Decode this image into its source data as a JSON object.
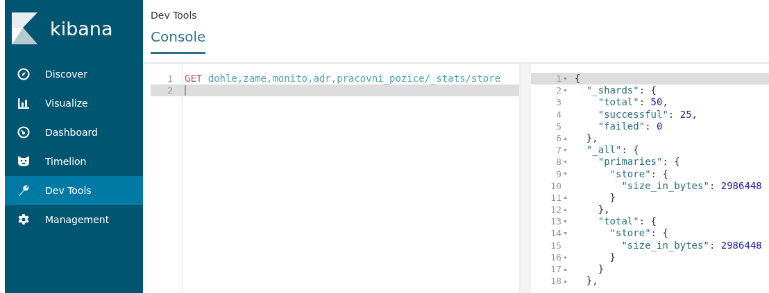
{
  "sidebar": {
    "logo_text": "kibana",
    "items": [
      {
        "label": "Discover",
        "selected": false
      },
      {
        "label": "Visualize",
        "selected": false
      },
      {
        "label": "Dashboard",
        "selected": false
      },
      {
        "label": "Timelion",
        "selected": false
      },
      {
        "label": "Dev Tools",
        "selected": true
      },
      {
        "label": "Management",
        "selected": false
      }
    ]
  },
  "breadcrumb": "Dev Tools",
  "tabs": [
    {
      "label": "Console",
      "selected": true
    }
  ],
  "request": {
    "lines": [
      {
        "number": "1",
        "active": false,
        "tokens": [
          {
            "kind": "method",
            "text": "GET"
          },
          {
            "kind": "url",
            "text": "dohle,zame,monito,adr,pracovni_pozice/_stats/store"
          }
        ]
      },
      {
        "number": "2",
        "active": true
      }
    ]
  },
  "response": {
    "lines": [
      {
        "number": "1",
        "fold_start": true,
        "fold_end": false,
        "active": true,
        "tokens": [
          {
            "kind": "punct",
            "text": "{"
          }
        ]
      },
      {
        "number": "2",
        "fold_start": true,
        "fold_end": false,
        "active": false,
        "tokens": [
          {
            "kind": "key",
            "text": "  \"_shards\""
          },
          {
            "kind": "punct",
            "text": ": {"
          }
        ]
      },
      {
        "number": "3",
        "fold_start": false,
        "fold_end": false,
        "active": false,
        "tokens": [
          {
            "kind": "key",
            "text": "    \"total\""
          },
          {
            "kind": "punct",
            "text": ": "
          },
          {
            "kind": "number",
            "text": "50"
          },
          {
            "kind": "punct",
            "text": ","
          }
        ]
      },
      {
        "number": "4",
        "fold_start": false,
        "fold_end": false,
        "active": false,
        "tokens": [
          {
            "kind": "key",
            "text": "    \"successful\""
          },
          {
            "kind": "punct",
            "text": ": "
          },
          {
            "kind": "number",
            "text": "25"
          },
          {
            "kind": "punct",
            "text": ","
          }
        ]
      },
      {
        "number": "5",
        "fold_start": false,
        "fold_end": false,
        "active": false,
        "tokens": [
          {
            "kind": "key",
            "text": "    \"failed\""
          },
          {
            "kind": "punct",
            "text": ": "
          },
          {
            "kind": "number",
            "text": "0"
          }
        ]
      },
      {
        "number": "6",
        "fold_start": false,
        "fold_end": true,
        "active": false,
        "tokens": [
          {
            "kind": "punct",
            "text": "  },"
          }
        ]
      },
      {
        "number": "7",
        "fold_start": true,
        "fold_end": false,
        "active": false,
        "tokens": [
          {
            "kind": "key",
            "text": "  \"_all\""
          },
          {
            "kind": "punct",
            "text": ": {"
          }
        ]
      },
      {
        "number": "8",
        "fold_start": true,
        "fold_end": false,
        "active": false,
        "tokens": [
          {
            "kind": "key",
            "text": "    \"primaries\""
          },
          {
            "kind": "punct",
            "text": ": {"
          }
        ]
      },
      {
        "number": "9",
        "fold_start": true,
        "fold_end": false,
        "active": false,
        "tokens": [
          {
            "kind": "key",
            "text": "      \"store\""
          },
          {
            "kind": "punct",
            "text": ": {"
          }
        ]
      },
      {
        "number": "10",
        "fold_start": false,
        "fold_end": false,
        "active": false,
        "tokens": [
          {
            "kind": "key",
            "text": "        \"size_in_bytes\""
          },
          {
            "kind": "punct",
            "text": ": "
          },
          {
            "kind": "number",
            "text": "2986448"
          }
        ]
      },
      {
        "number": "11",
        "fold_start": false,
        "fold_end": true,
        "active": false,
        "tokens": [
          {
            "kind": "punct",
            "text": "      }"
          }
        ]
      },
      {
        "number": "12",
        "fold_start": false,
        "fold_end": true,
        "active": false,
        "tokens": [
          {
            "kind": "punct",
            "text": "    },"
          }
        ]
      },
      {
        "number": "13",
        "fold_start": true,
        "fold_end": false,
        "active": false,
        "tokens": [
          {
            "kind": "key",
            "text": "    \"total\""
          },
          {
            "kind": "punct",
            "text": ": {"
          }
        ]
      },
      {
        "number": "14",
        "fold_start": true,
        "fold_end": false,
        "active": false,
        "tokens": [
          {
            "kind": "key",
            "text": "      \"store\""
          },
          {
            "kind": "punct",
            "text": ": {"
          }
        ]
      },
      {
        "number": "15",
        "fold_start": false,
        "fold_end": false,
        "active": false,
        "tokens": [
          {
            "kind": "key",
            "text": "        \"size_in_bytes\""
          },
          {
            "kind": "punct",
            "text": ": "
          },
          {
            "kind": "number",
            "text": "2986448"
          }
        ]
      },
      {
        "number": "16",
        "fold_start": false,
        "fold_end": true,
        "active": false,
        "tokens": [
          {
            "kind": "punct",
            "text": "      }"
          }
        ]
      },
      {
        "number": "17",
        "fold_start": false,
        "fold_end": true,
        "active": false,
        "tokens": [
          {
            "kind": "punct",
            "text": "    }"
          }
        ]
      },
      {
        "number": "18",
        "fold_start": false,
        "fold_end": true,
        "active": false,
        "tokens": [
          {
            "kind": "punct",
            "text": "  },"
          }
        ]
      }
    ]
  }
}
